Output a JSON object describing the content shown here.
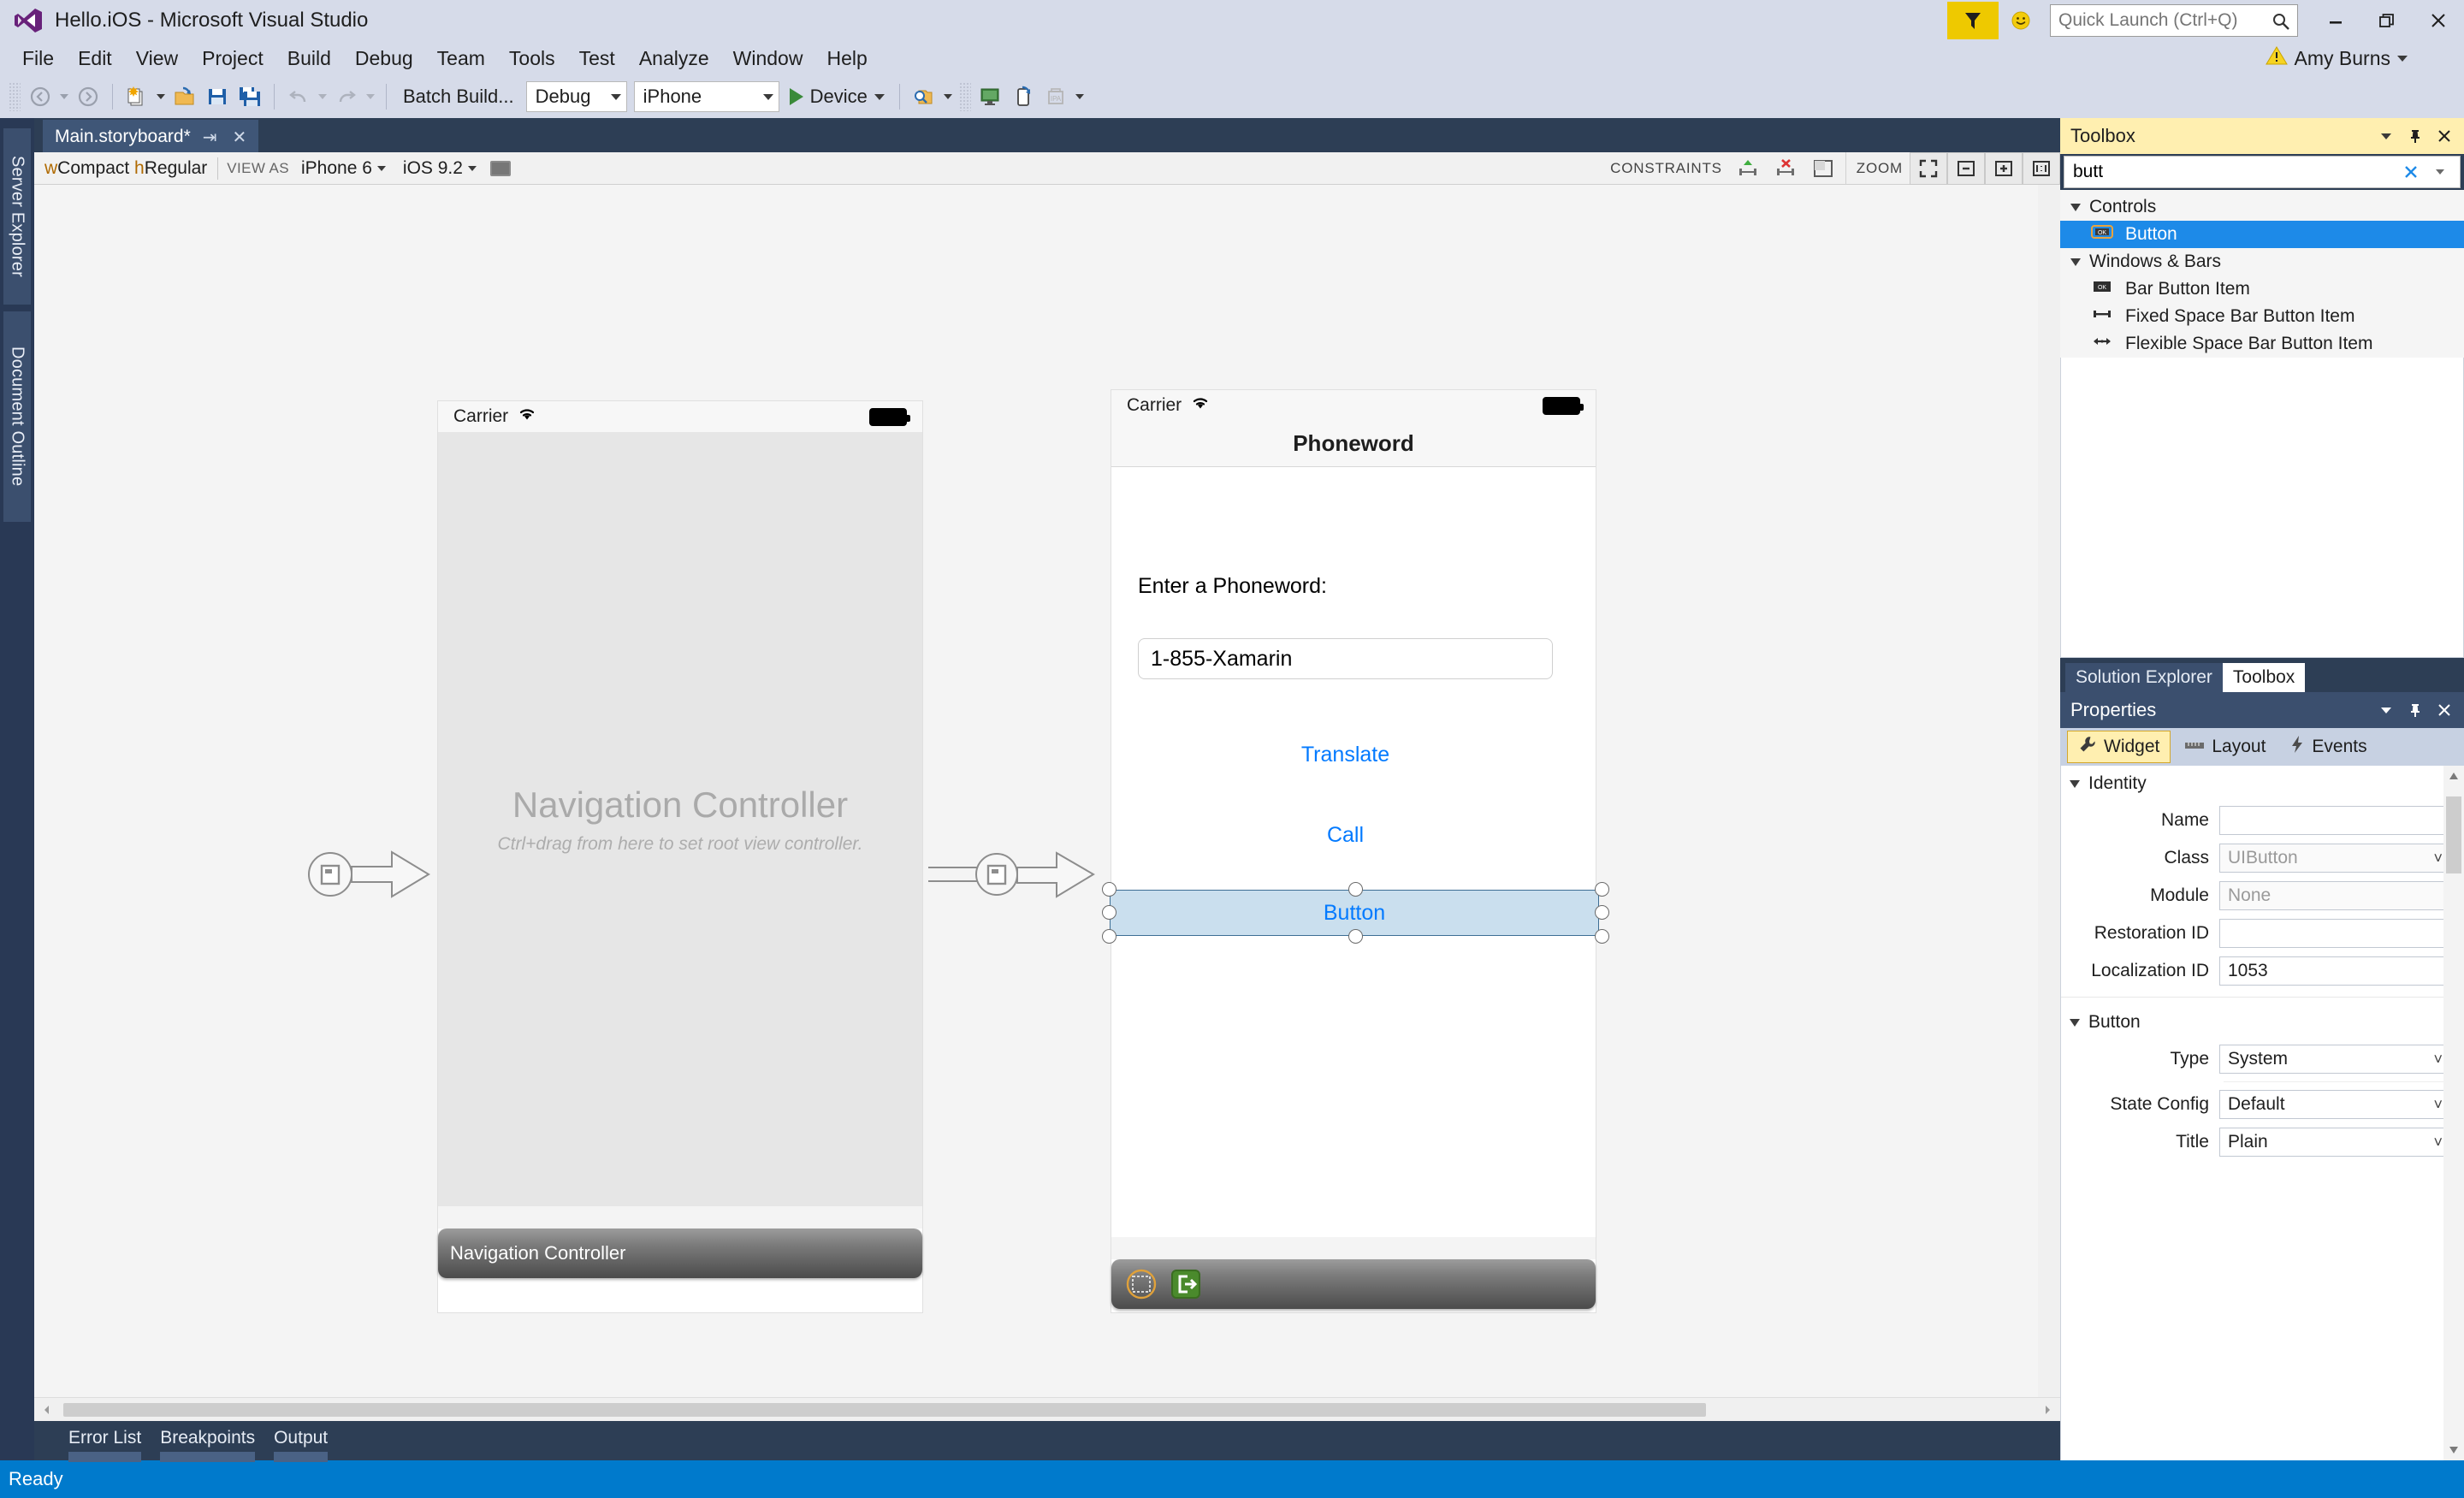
{
  "window": {
    "title": "Hello.iOS - Microsoft Visual Studio",
    "user": "Amy Burns",
    "quick_launch_placeholder": "Quick Launch (Ctrl+Q)",
    "minimize_label": "Minimize",
    "restore_label": "Restore",
    "close_label": "Close"
  },
  "menubar": {
    "items": [
      "File",
      "Edit",
      "View",
      "Project",
      "Build",
      "Debug",
      "Team",
      "Tools",
      "Test",
      "Analyze",
      "Window",
      "Help"
    ]
  },
  "toolbar": {
    "batch_build": "Batch Build...",
    "configuration": "Debug",
    "platform": "iPhone",
    "run_target": "Device"
  },
  "left_rail": {
    "tabs": [
      "Server Explorer",
      "Document Outline"
    ]
  },
  "document": {
    "tab_label": "Main.storyboard*",
    "pin_glyph": "⇥",
    "close_glyph": "✕"
  },
  "designer_toolbar": {
    "trait": "wCompact hRegular",
    "trait_w": "w",
    "trait_compact": "Compact ",
    "trait_h": "h",
    "trait_regular": "Regular",
    "view_as_label": "VIEW AS",
    "device": "iPhone 6",
    "os_version": "iOS 9.2",
    "constraints_label": "CONSTRAINTS",
    "zoom_label": "ZOOM"
  },
  "canvas": {
    "scene_nav": {
      "carrier": "Carrier",
      "placeholder_title": "Navigation Controller",
      "placeholder_subtitle": "Ctrl+drag from here to set root view controller.",
      "footer_label": "Navigation Controller"
    },
    "scene_phoneword": {
      "carrier": "Carrier",
      "nav_title": "Phoneword",
      "prompt_label": "Enter a Phoneword:",
      "text_field_value": "1-855-Xamarin",
      "translate_button": "Translate",
      "call_button": "Call",
      "selected_button": "Button"
    }
  },
  "toolbox": {
    "title": "Toolbox",
    "search_value": "butt",
    "groups": [
      {
        "name": "Controls",
        "items": [
          {
            "label": "Button",
            "selected": true,
            "icon": "button-icon"
          }
        ]
      },
      {
        "name": "Windows & Bars",
        "items": [
          {
            "label": "Bar Button Item",
            "selected": false,
            "icon": "bar-button-item-icon"
          },
          {
            "label": "Fixed Space Bar Button Item",
            "selected": false,
            "icon": "fixed-space-icon"
          },
          {
            "label": "Flexible Space Bar Button Item",
            "selected": false,
            "icon": "flexible-space-icon"
          }
        ]
      }
    ]
  },
  "dock_tabs": {
    "solution_explorer": "Solution Explorer",
    "toolbox": "Toolbox"
  },
  "properties": {
    "title": "Properties",
    "tabs": [
      {
        "label": "Widget",
        "icon": "wrench-icon",
        "active": true
      },
      {
        "label": "Layout",
        "icon": "ruler-icon",
        "active": false
      },
      {
        "label": "Events",
        "icon": "lightning-icon",
        "active": false
      }
    ],
    "identity_group": "Identity",
    "button_group": "Button",
    "rows": [
      {
        "label": "Name",
        "value": "",
        "placeholder": "",
        "kind": "text"
      },
      {
        "label": "Class",
        "value": "",
        "placeholder": "UIButton",
        "kind": "combo"
      },
      {
        "label": "Module",
        "value": "",
        "placeholder": "None",
        "kind": "text"
      },
      {
        "label": "Restoration ID",
        "value": "",
        "placeholder": "",
        "kind": "text"
      },
      {
        "label": "Localization ID",
        "value": "1053",
        "placeholder": "",
        "kind": "text"
      }
    ],
    "button_rows": [
      {
        "label": "Type",
        "value": "System",
        "kind": "combo"
      },
      {
        "label": "State Config",
        "value": "Default",
        "kind": "combo"
      },
      {
        "label": "Title",
        "value": "Plain",
        "kind": "combo"
      }
    ]
  },
  "bottom_tabs": {
    "items": [
      "Error List",
      "Breakpoints",
      "Output"
    ]
  },
  "statusbar": {
    "text": "Ready"
  },
  "colors": {
    "chrome": "#d6dbe9",
    "dock": "#2d3e55",
    "accent_blue": "#007acc",
    "toolbox_header": "#ffefb0",
    "selection_blue": "#1d8ae8",
    "ios_tint": "#037aff",
    "selected_widget_fill": "#cadfee"
  }
}
